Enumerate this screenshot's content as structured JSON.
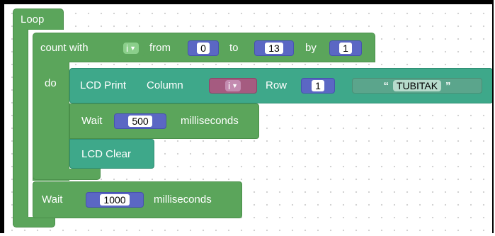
{
  "loop_block": {
    "label": "Loop"
  },
  "for_block": {
    "count_with_label": "count with",
    "variable": "i",
    "from_label": "from",
    "from_value": "0",
    "to_label": "to",
    "to_value": "13",
    "by_label": "by",
    "by_value": "1",
    "do_label": "do"
  },
  "lcd_print_block": {
    "label": "LCD Print",
    "column_label": "Column",
    "column_variable": "i",
    "row_label": "Row",
    "row_value": "1",
    "open_quote": "“",
    "text_value": "TUBITAK",
    "close_quote": "”"
  },
  "wait_inner_block": {
    "label": "Wait",
    "value": "500",
    "unit": "milliseconds"
  },
  "lcd_clear_block": {
    "label": "LCD Clear"
  },
  "wait_outer_block": {
    "label": "Wait",
    "value": "1000",
    "unit": "milliseconds"
  },
  "colors": {
    "loop_green": "#5ba55b",
    "lcd_teal": "#3ea88a",
    "number_blue": "#5b67c4",
    "variable_pink": "#a55b80"
  }
}
